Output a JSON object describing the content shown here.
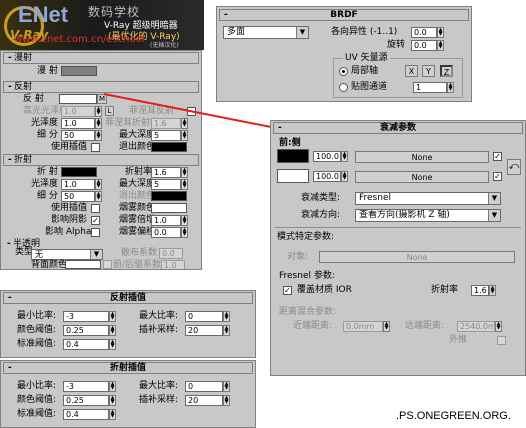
{
  "logo": {
    "brand": "ENet",
    "brand_cn": "数码学校",
    "tagline1": "V-Ray 超级明暗器",
    "tagline2": "(最优化的 V-Ray)",
    "tagline3": "(无插汉化)",
    "url": "www.enet.com.cn/eschool",
    "vray": "V-Ray"
  },
  "brdf": {
    "title": "BRDF",
    "type_value": "多面",
    "aniso_label": "各向异性 (-1..1)",
    "aniso_value": "0.0",
    "rotate_label": "旋转",
    "rotate_value": "0.0",
    "uv_group": "UV 矢量源",
    "local_axis": "局部轴",
    "axes": [
      "X",
      "Y",
      "Z"
    ],
    "map_channel": "贴图通道",
    "map_value": "1"
  },
  "left": {
    "roll_basic": "漫射",
    "diffuse": "漫 射",
    "roll_reflect": "反射",
    "reflect": "反 射",
    "m_button": "M",
    "hilight_gloss": "高光光泽度",
    "hilight_val": "1.0",
    "l_button": "L",
    "fresnel_refl": "菲涅耳反射",
    "gloss": "光泽度",
    "gloss_val": "1.0",
    "fresnel_ior": "菲涅耳折射率",
    "fresnel_ior_val": "1.6",
    "subdivs": "细 分",
    "subdivs_val": "50",
    "max_depth": "最大深度",
    "max_depth_val": "5",
    "use_interp": "使用插值",
    "exit_color": "退出颜色",
    "roll_refract": "折射",
    "refract": "折 射",
    "ior": "折射率",
    "ior_val": "1.6",
    "gloss2_val": "1.0",
    "max_depth2_val": "5",
    "subdivs2_val": "50",
    "exit_color2": "退出颜色",
    "use_interp2": "使用插值",
    "fog_color": "烟雾颜色",
    "affect_shadows": "影响阴影",
    "fog_mult": "烟雾倍增",
    "fog_mult_val": "1.0",
    "affect_alpha": "影响 Alpha",
    "fog_bias": "烟雾偏移",
    "fog_bias_val": "0.0",
    "roll_translucent": "半透明",
    "type_label": "类型",
    "type_value": "无",
    "scatter": "散布系数",
    "scatter_val": "0.0",
    "back_color": "背面颜色",
    "fwd_back": "前/后驱系数",
    "fwd_back_val": "1.0"
  },
  "falloff": {
    "title": "衰减参数",
    "front_side": "前:侧",
    "val1": "100.0",
    "none": "None",
    "val2": "100.0",
    "falloff_type": "衰减类型:",
    "falloff_type_value": "Fresnel",
    "falloff_dir": "衰减方向:",
    "falloff_dir_value": "查看方向(摄影机 Z 轴)",
    "mode_specific": "模式特定参数:",
    "object": "对象:",
    "object_value": "None",
    "fresnel_params": "Fresnel 参数:",
    "override_ior": "覆盖材质 IOR",
    "ior_label": "折射率",
    "ior_value": "1.6",
    "dist_blend": "距离混合参数:",
    "near_dist": "近端距离:",
    "near_val": "0.0mm",
    "far_dist": "远端距离:",
    "far_val": "2540.0m",
    "extrapolate": "外推"
  },
  "reflect_interp": {
    "title": "反射插值",
    "min_rate": "最小比率:",
    "min_val": "-3",
    "max_rate": "最大比率:",
    "max_val": "0",
    "clr_thresh": "颜色阈值:",
    "clr_val": "0.25",
    "interp_samples": "插补采样:",
    "interp_val": "20",
    "nrm_thresh": "标准阈值:",
    "nrm_val": "0.4"
  },
  "refract_interp": {
    "title": "折射插值",
    "min_rate": "最小比率:",
    "min_val": "-3",
    "max_rate": "最大比率:",
    "max_val": "0",
    "clr_thresh": "颜色阈值:",
    "clr_val": "0.25",
    "interp_samples": "插补采样:",
    "interp_val": "20",
    "nrm_thresh": "标准阈值:",
    "nrm_val": "0.4"
  },
  "watermark": ".PS.ONEGREEN.ORG."
}
